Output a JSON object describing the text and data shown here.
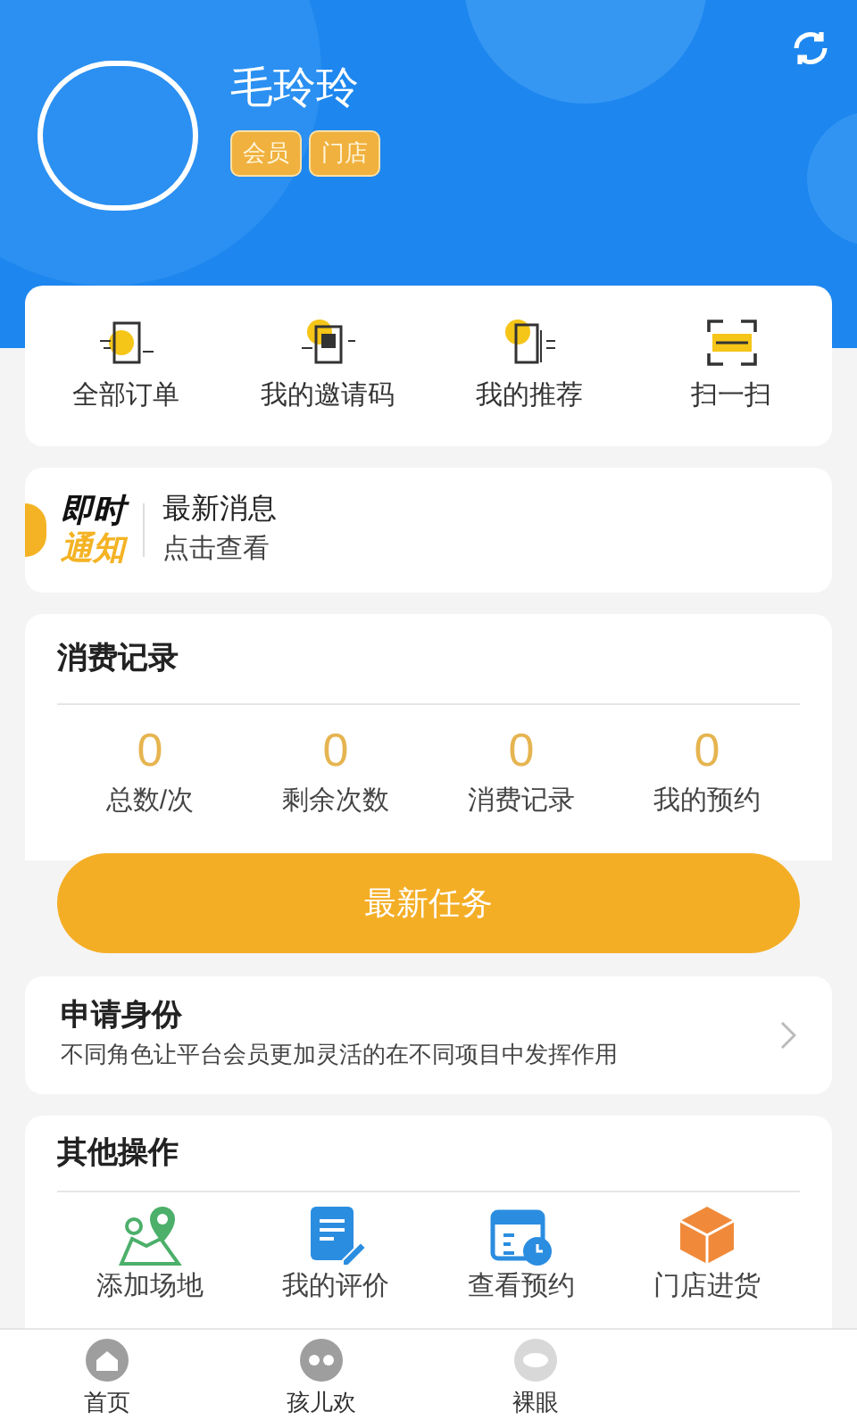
{
  "profile": {
    "name": "毛玲玲",
    "tags": [
      "会员",
      "门店"
    ]
  },
  "shortcuts": [
    {
      "label": "全部订单",
      "kind": "orders"
    },
    {
      "label": "我的邀请码",
      "kind": "invite"
    },
    {
      "label": "我的推荐",
      "kind": "recommend"
    },
    {
      "label": "扫一扫",
      "kind": "scan"
    }
  ],
  "notice": {
    "badge_top": "即时",
    "badge_bottom": "通知",
    "title": "最新消息",
    "subtitle": "点击查看"
  },
  "consumption": {
    "title": "消费记录",
    "stats": [
      {
        "value": "0",
        "label": "总数/次"
      },
      {
        "value": "0",
        "label": "剩余次数"
      },
      {
        "value": "0",
        "label": "消费记录"
      },
      {
        "value": "0",
        "label": "我的预约"
      }
    ]
  },
  "task_button": "最新任务",
  "apply": {
    "title": "申请身份",
    "description": "不同角色让平台会员更加灵活的在不同项目中发挥作用"
  },
  "other": {
    "title": "其他操作",
    "items": [
      {
        "label": "添加场地",
        "kind": "map"
      },
      {
        "label": "我的评价",
        "kind": "review"
      },
      {
        "label": "查看预约",
        "kind": "calendar"
      },
      {
        "label": "门店进货",
        "kind": "box"
      }
    ]
  },
  "bottom_nav": [
    {
      "label": "首页",
      "kind": "home",
      "selected": false
    },
    {
      "label": "孩儿欢",
      "kind": "kids",
      "selected": false
    },
    {
      "label": "裸眼",
      "kind": "eye",
      "selected": false
    }
  ]
}
